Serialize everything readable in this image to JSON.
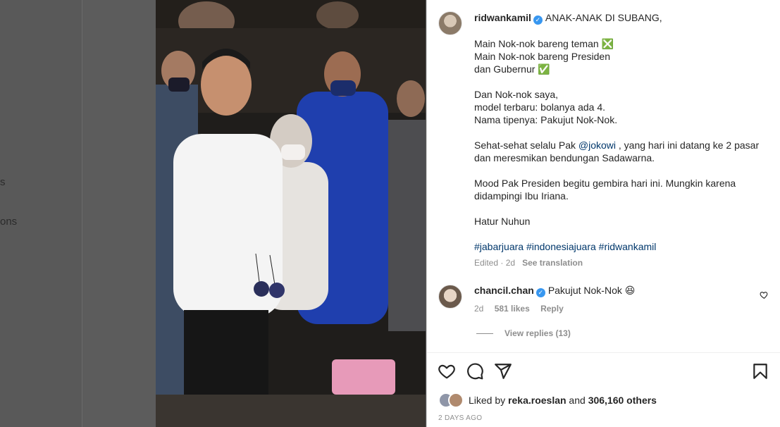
{
  "sidebar": {
    "partial_item_1": "s",
    "partial_item_2": "ons"
  },
  "post": {
    "author": "ridwankamil",
    "caption_lines": [
      "ANAK-ANAK DI SUBANG,",
      "",
      "Main Nok-nok bareng teman ❎",
      "Main Nok-nok bareng Presiden",
      "dan Gubernur ✅",
      "",
      "Dan Nok-nok saya,",
      "model terbaru: bolanya ada 4.",
      "Nama tipenya: Pakujut Nok-Nok.",
      "",
      "Sehat-sehat selalu Pak ",
      "dan meresmikan bendungan Sadawarna.",
      "",
      "Mood Pak Presiden begitu gembira hari ini. Mungkin karena",
      "didampingi Ibu Iriana.",
      "",
      "Hatur Nuhun",
      ""
    ],
    "mention": "@jokowi",
    "mention_suffix": " , yang hari ini datang ke 2 pasar",
    "hashtags": "#jabarjuara #indonesiajuara #ridwankamil",
    "edited": "Edited · 2d",
    "see_translation": "See translation"
  },
  "comment": {
    "author": "chancil.chan",
    "text": "Pakujut Nok-Nok 😆",
    "time": "2d",
    "likes": "581 likes",
    "reply": "Reply",
    "view_replies": "View replies (13)"
  },
  "likes": {
    "prefix": "Liked by ",
    "user": "reka.roeslan",
    "and": " and ",
    "others": "306,160 others"
  },
  "timestamp": "2 DAYS AGO",
  "colors": {
    "verified": "#3897f0",
    "link": "#00376b",
    "secondary_text": "#8e8e8e"
  },
  "icons": [
    "heart-icon",
    "comment-icon",
    "share-icon",
    "bookmark-icon",
    "verified-badge-icon"
  ]
}
